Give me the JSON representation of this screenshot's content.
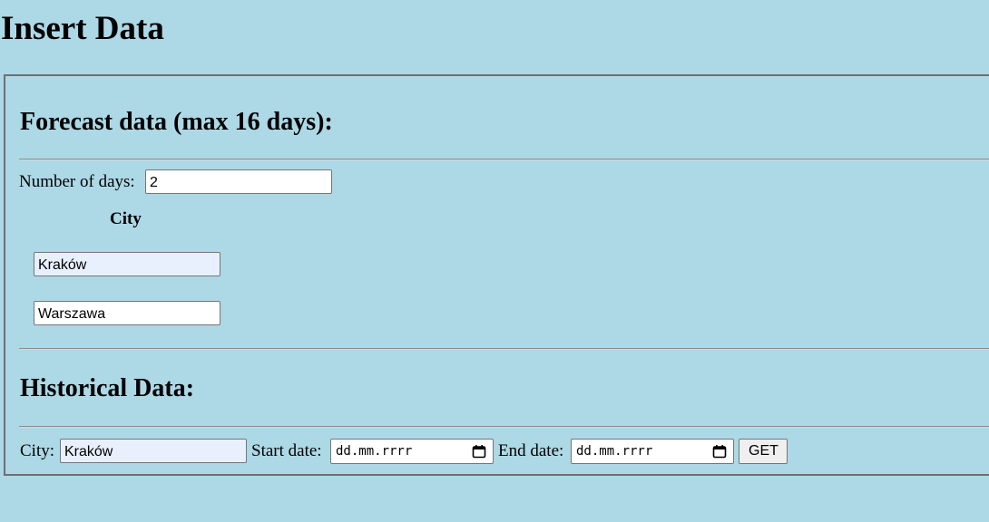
{
  "page": {
    "title": "Insert Data"
  },
  "forecast": {
    "title": "Forecast data (max 16 days):",
    "days_label": "Number of days:",
    "days_value": "2",
    "city_column_header": "City",
    "cities": [
      "Kraków",
      "Warszawa"
    ]
  },
  "historical": {
    "title": "Historical Data:",
    "city_label": "City:",
    "city_value": "Kraków",
    "start_label": "Start date:",
    "start_placeholder": "dd.mm.rrrr",
    "end_label": "End date:",
    "end_placeholder": "dd.mm.rrrr",
    "get_label": "GET"
  },
  "icons": {
    "date_picker": "calendar-icon"
  },
  "colors": {
    "background": "#add8e6",
    "autofill": "#e8f0fe",
    "button": "#efefef"
  }
}
